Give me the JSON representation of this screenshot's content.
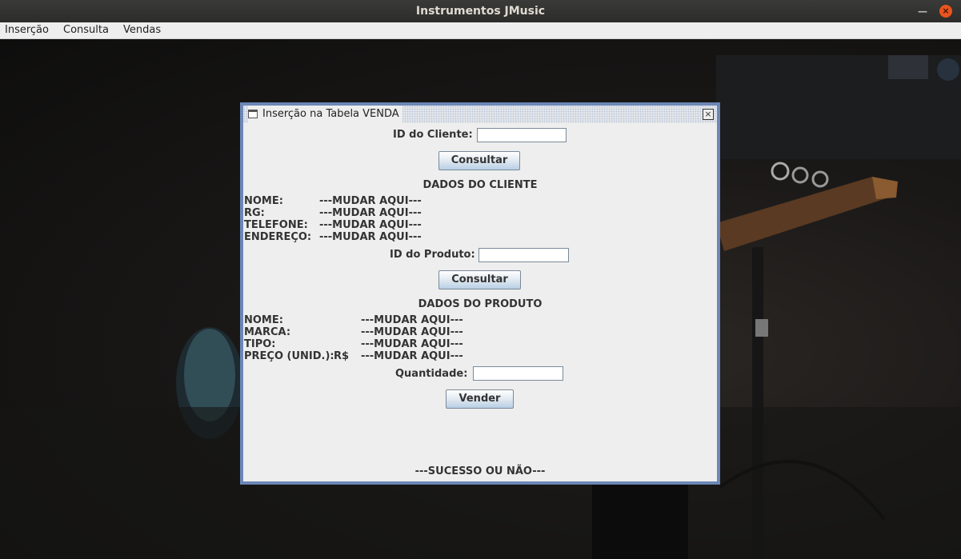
{
  "window": {
    "title": "Instrumentos JMusic",
    "minimize_glyph": "—",
    "close_glyph": "×"
  },
  "menubar": {
    "items": [
      "Inserção",
      "Consulta",
      "Vendas"
    ]
  },
  "internal_frame": {
    "title": "Inserção na Tabela VENDA",
    "close_glyph": "×",
    "client_id_label": "ID do Cliente:",
    "client_id_value": "",
    "consult_client_button": "Consultar",
    "client_section_title": "DADOS DO CLIENTE",
    "client_fields": [
      {
        "label": "NOME:",
        "value": "---MUDAR AQUI---"
      },
      {
        "label": "RG:",
        "value": "---MUDAR AQUI---"
      },
      {
        "label": "TELEFONE:",
        "value": "---MUDAR AQUI---"
      },
      {
        "label": "ENDEREÇO:",
        "value": "---MUDAR AQUI---"
      }
    ],
    "product_id_label": "ID do Produto:",
    "product_id_value": "",
    "consult_product_button": "Consultar",
    "product_section_title": "DADOS DO PRODUTO",
    "product_fields": [
      {
        "label": "NOME:",
        "prefix": "",
        "value": "---MUDAR AQUI---"
      },
      {
        "label": "MARCA:",
        "prefix": "",
        "value": "---MUDAR AQUI---"
      },
      {
        "label": "TIPO:",
        "prefix": "",
        "value": "---MUDAR AQUI---"
      },
      {
        "label": "PREÇO (UNID.):",
        "prefix": "R$",
        "value": "---MUDAR AQUI---"
      }
    ],
    "quantity_label": "Quantidade:",
    "quantity_value": "",
    "sell_button": "Vender",
    "status_text": "---SUCESSO OU NÃO---"
  }
}
